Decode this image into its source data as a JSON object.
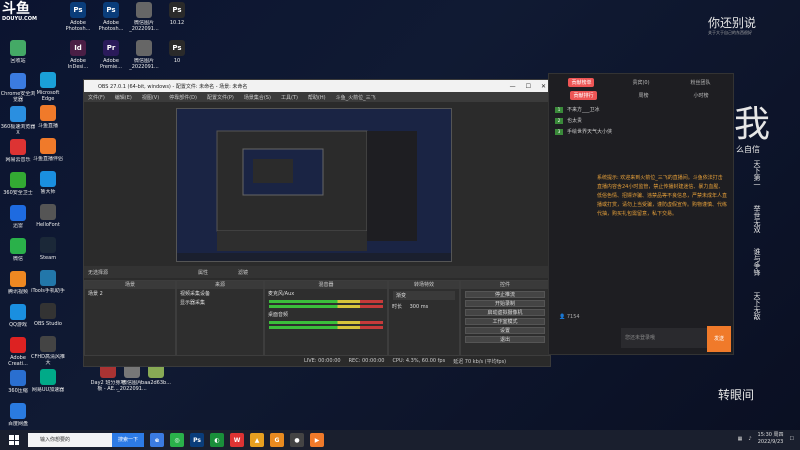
{
  "desktop": {
    "logo_text": "DOUYU.COM",
    "icons": [
      {
        "label": "回收站",
        "color": "#4a6"
      },
      {
        "label": "Chrome安全浏览器",
        "color": "#3b7be0"
      },
      {
        "label": "360极速浏览器X",
        "color": "#2a8fe0"
      },
      {
        "label": "网易云音乐",
        "color": "#d33"
      },
      {
        "label": "360安全卫士",
        "color": "#3a3"
      },
      {
        "label": "迅雷",
        "color": "#1e6be0"
      },
      {
        "label": "微信",
        "color": "#2ab14a"
      },
      {
        "label": "腾讯视频",
        "color": "#e82"
      },
      {
        "label": "QQ游戏",
        "color": "#1a8fe0"
      },
      {
        "label": "Adobe Creati...",
        "color": "#d22"
      },
      {
        "label": "360压缩",
        "color": "#2a6fd0"
      },
      {
        "label": "百度网盘",
        "color": "#2a7be0"
      }
    ],
    "col2": [
      {
        "label": "Microsoft Edge",
        "color": "#1aa0d8"
      },
      {
        "label": "斗鱼直播",
        "color": "#f07a2a"
      },
      {
        "label": "斗鱼直播伴侣",
        "color": "#f07a2a"
      },
      {
        "label": "鲁大师",
        "color": "#1a8fe0"
      },
      {
        "label": "HelloFont",
        "color": "#555"
      },
      {
        "label": "Steam",
        "color": "#1b2838"
      },
      {
        "label": "iTools手机助手",
        "color": "#27a"
      },
      {
        "label": "OBS Studio",
        "color": "#333"
      },
      {
        "label": "CFHD高清风推大",
        "color": "#444"
      },
      {
        "label": "网易UU加速器",
        "color": "#0a8"
      }
    ],
    "top_row": [
      {
        "label": "Adobe Photosh...",
        "color": "#0a3d7a",
        "glyph": "Ps"
      },
      {
        "label": "Adobe Photosh...",
        "color": "#0a3d7a",
        "glyph": "Ps"
      },
      {
        "label": "微信图片_2022091...",
        "color": "#666",
        "glyph": ""
      },
      {
        "label": "10.12",
        "color": "#2a2a2a",
        "glyph": "Ps"
      }
    ],
    "row2": [
      {
        "label": "Adobe InDesi...",
        "color": "#4a1e45",
        "glyph": "Id"
      },
      {
        "label": "Adobe Premie...",
        "color": "#2a1a5a",
        "glyph": "Pr"
      },
      {
        "label": "微信图片_2022091...",
        "color": "#666",
        "glyph": ""
      },
      {
        "label": "10",
        "color": "#2a2a2a",
        "glyph": "Ps"
      }
    ],
    "bottom_files": [
      {
        "label": "Day2 班分身地板 - AE...",
        "color": "#a33"
      },
      {
        "label": "微信图片_2022091...",
        "color": "#777"
      },
      {
        "label": "baa2d63b...",
        "color": "#8a5"
      }
    ],
    "art_lines": [
      "你还别说",
      "我",
      "么自信",
      "天下第一",
      "举世无双",
      "谁与争锋",
      "天下无敌",
      "转眼间"
    ],
    "art_small": "关于大于自己的东西很好"
  },
  "obs": {
    "title": "OBS 27.0.1 (64-bit, windows) - 配置文件: 未命名 - 场景: 未命名",
    "menu": [
      "文件(F)",
      "编辑(E)",
      "视图(V)",
      "停靠部件(D)",
      "配置文件(P)",
      "场景集合(S)",
      "工具(T)",
      "帮助(H)",
      "斗鱼_火箭位_三飞"
    ],
    "source_bar": {
      "label": "无选择源",
      "props": "属性",
      "filters": "滤镜"
    },
    "docks": {
      "scenes": {
        "title": "场景",
        "items": [
          "场景 2"
        ]
      },
      "sources": {
        "title": "来源",
        "items": [
          "视频采集设备",
          "显示器采集"
        ]
      },
      "mixer": {
        "title": "混音器",
        "items": [
          "麦克风/Aux",
          "桌面音频"
        ]
      },
      "transitions": {
        "title": "转场特效",
        "type": "渐变",
        "duration_label": "时长",
        "duration": "300 ms"
      },
      "controls": {
        "title": "控件",
        "buttons": [
          "停止推流",
          "开始录制",
          "启动虚拟摄像机",
          "工作室模式",
          "设置",
          "退出"
        ]
      }
    },
    "status": [
      "LIVE: 00:00:00",
      "REC: 00:00:00",
      "CPU: 4.3%, 60.00 fps",
      "延迟 70 kb/s (平均fps)"
    ]
  },
  "douyu": {
    "tabs": [
      "贡献榜单",
      "贵宾(0)",
      "粉丝团队"
    ],
    "subtabs": [
      "贡献排行",
      "周榜",
      "小时榜"
    ],
    "ranks": [
      {
        "rank": "1",
        "name": "不来方___卫冰"
      },
      {
        "rank": "2",
        "name": "也太贵"
      },
      {
        "rank": "3",
        "name": "手绘世界天气大小侠"
      }
    ],
    "system_message": "系统提示: 欢迎来到火箭位_三飞的直播间。斗鱼依法打击直播内容含24小时监管，禁止传播封建迷信、暴力血腥、低俗色情、招嫖诈骗、违禁品等不良信息，严禁未成年人直播或打赏，请勿上当受骗，谨防虚假宣传。购物谨慎、代练代抽，购买礼包需留意，私下交易。",
    "online_count": "7154",
    "input_placeholder": "您还未登录哦",
    "send_label": "发送"
  },
  "taskbar": {
    "search_placeholder": "输入你想要的",
    "search_button": "搜索一下",
    "time": "15:30 周四",
    "date": "2022/9/23",
    "apps": [
      {
        "color": "#3b7be0",
        "glyph": "e"
      },
      {
        "color": "#2ab14a",
        "glyph": "◎"
      },
      {
        "color": "#0a3d7a",
        "glyph": "Ps"
      },
      {
        "color": "#1a8f3a",
        "glyph": "◐"
      },
      {
        "color": "#d33",
        "glyph": "W"
      },
      {
        "color": "#e8a020",
        "glyph": "▲"
      },
      {
        "color": "#e88a20",
        "glyph": "G"
      },
      {
        "color": "#444",
        "glyph": "●"
      },
      {
        "color": "#f07a2a",
        "glyph": "▶"
      }
    ]
  }
}
